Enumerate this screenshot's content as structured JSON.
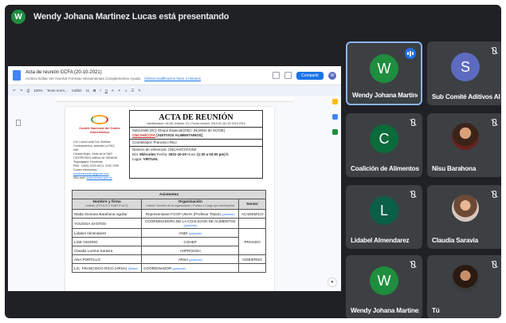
{
  "header": {
    "presenter_initial": "W",
    "presenting_text": "Wendy Johana Martinez Lucas está presentando"
  },
  "doc": {
    "title": "Acta de reunión CCFA (20-10-2021)",
    "menu": "Archivo  Editar  Ver  Insertar  Formato  Herramientas  Complementos  Ayuda",
    "last_edit": "Última modificación hace 3 minutos",
    "share_label": "Compartir",
    "user_initial": "W",
    "toolbar_zoom": "100%",
    "toolbar_style": "Texto norm...",
    "toolbar_font": "Calibri",
    "toolbar_size": "11",
    "logo_text": "Comité Nacional del Codex Alimentarius",
    "contact_lines": [
      "Col. Loma Linda Sur, Bulevar",
      "Centroamérica, avenida La FAO, edif.",
      "Ciudad Mujer, Sede de la SAG",
      "OICEPR/SAG edificio de SENASA",
      "Tegucigalpa, Honduras",
      "PBX: +(504) 2232-6213, 2232-7299",
      "Correo electrónico:"
    ],
    "email": "hondurascodex@gmail.com",
    "web_label": "Sitio web:",
    "web": "www.senasa.gob.hn",
    "acta_title": "ACTA DE REUNIÓN",
    "id_line": "Identificación: 04-08 | Edición: 01 | Fecha versión: 2019-02-18 | ID 0015 2019",
    "subcommittee": "Subcomité [SC] /Grupo Especial [GE] / (Nombre de SC/GE)",
    "committee_code": "CNCAH/CCFA",
    "committee_name": "[ADITIVOS ALIMENTARIOS]",
    "coordinator": "Coordinador: Francisco Rico",
    "reference": "Número de referencia: CNCAH/CCFA/N2",
    "day_label": "Día:",
    "day": "Miércoles",
    "date_label": "Fecha:",
    "date": "2021-10-20",
    "time_label": "Hora:",
    "time": "(1:30 a 04:00 pm) h",
    "place_label": "Lugar:",
    "place": "VIRTUAL",
    "table": {
      "title": "Asistentes",
      "col_name": "Nombre y firma",
      "col_name_sub": "Indicar: (TITULO O SUBTITULO)",
      "col_org": "Organización",
      "col_org_sub": "Indicar: Nombre de la organización / Puesto o Cargo que desempeña",
      "col_sector": "Sector",
      "rows": [
        {
          "name": "Nitida Xiomara Barahona Aguilar",
          "org": "Representante FCGP-UNAH (Profesor Titular)",
          "org_mention": "(presente)",
          "sector": "ACADEMICO"
        },
        {
          "name": "YOUSSIA SANTOS",
          "org": "COORDINADORA DE LA COALICION DE ALIMENTOS",
          "org_mention": "(presente)",
          "sector": ""
        },
        {
          "name": "Lidabel Almendarez",
          "org": "ANDI",
          "org_mention": "(presente)",
          "sector": "PRIVADO"
        },
        {
          "name": "LISE OSORIO",
          "org": "COHEP",
          "org_mention": "",
          "sector": ""
        },
        {
          "name": "Claudia Lorena Saravia",
          "org": "AHPROCEH",
          "org_mention": "",
          "sector": ""
        },
        {
          "name": "ANA PORTILLO",
          "org": "ARSA",
          "org_mention": "(presente)",
          "sector": "GOBIERNO"
        },
        {
          "name": "LIC. FRANCISCO RICO (ARSA)",
          "name_mention": "(Mirlan)",
          "org": "COORDINADOR",
          "org_mention": "(presente)",
          "sector": ""
        }
      ]
    }
  },
  "participants": [
    {
      "name": "Wendy Johana Martinez L...",
      "initial": "W",
      "color": "#1e8e3e",
      "active": true,
      "speaking": true
    },
    {
      "name": "Sub Comité Aditivos Alim...",
      "initial": "S",
      "color": "#5c6bc0",
      "active": false,
      "speaking": false
    },
    {
      "name": "Coalición de Alimentos y ...",
      "initial": "C",
      "color": "#0b6b3a",
      "active": false,
      "speaking": false
    },
    {
      "name": "Nisu Barahona",
      "initial": "",
      "color": "",
      "active": false,
      "speaking": false
    },
    {
      "name": "Lidabel Almendarez",
      "initial": "L",
      "color": "#0b5e47",
      "active": false,
      "speaking": false
    },
    {
      "name": "Claudia Saravia",
      "initial": "",
      "color": "",
      "active": false,
      "speaking": false
    },
    {
      "name": "Wendy Johana Martinez L...",
      "initial": "W",
      "color": "#1e8e3e",
      "active": false,
      "speaking": false
    },
    {
      "name": "Tú",
      "initial": "",
      "color": "",
      "active": false,
      "speaking": false
    }
  ]
}
